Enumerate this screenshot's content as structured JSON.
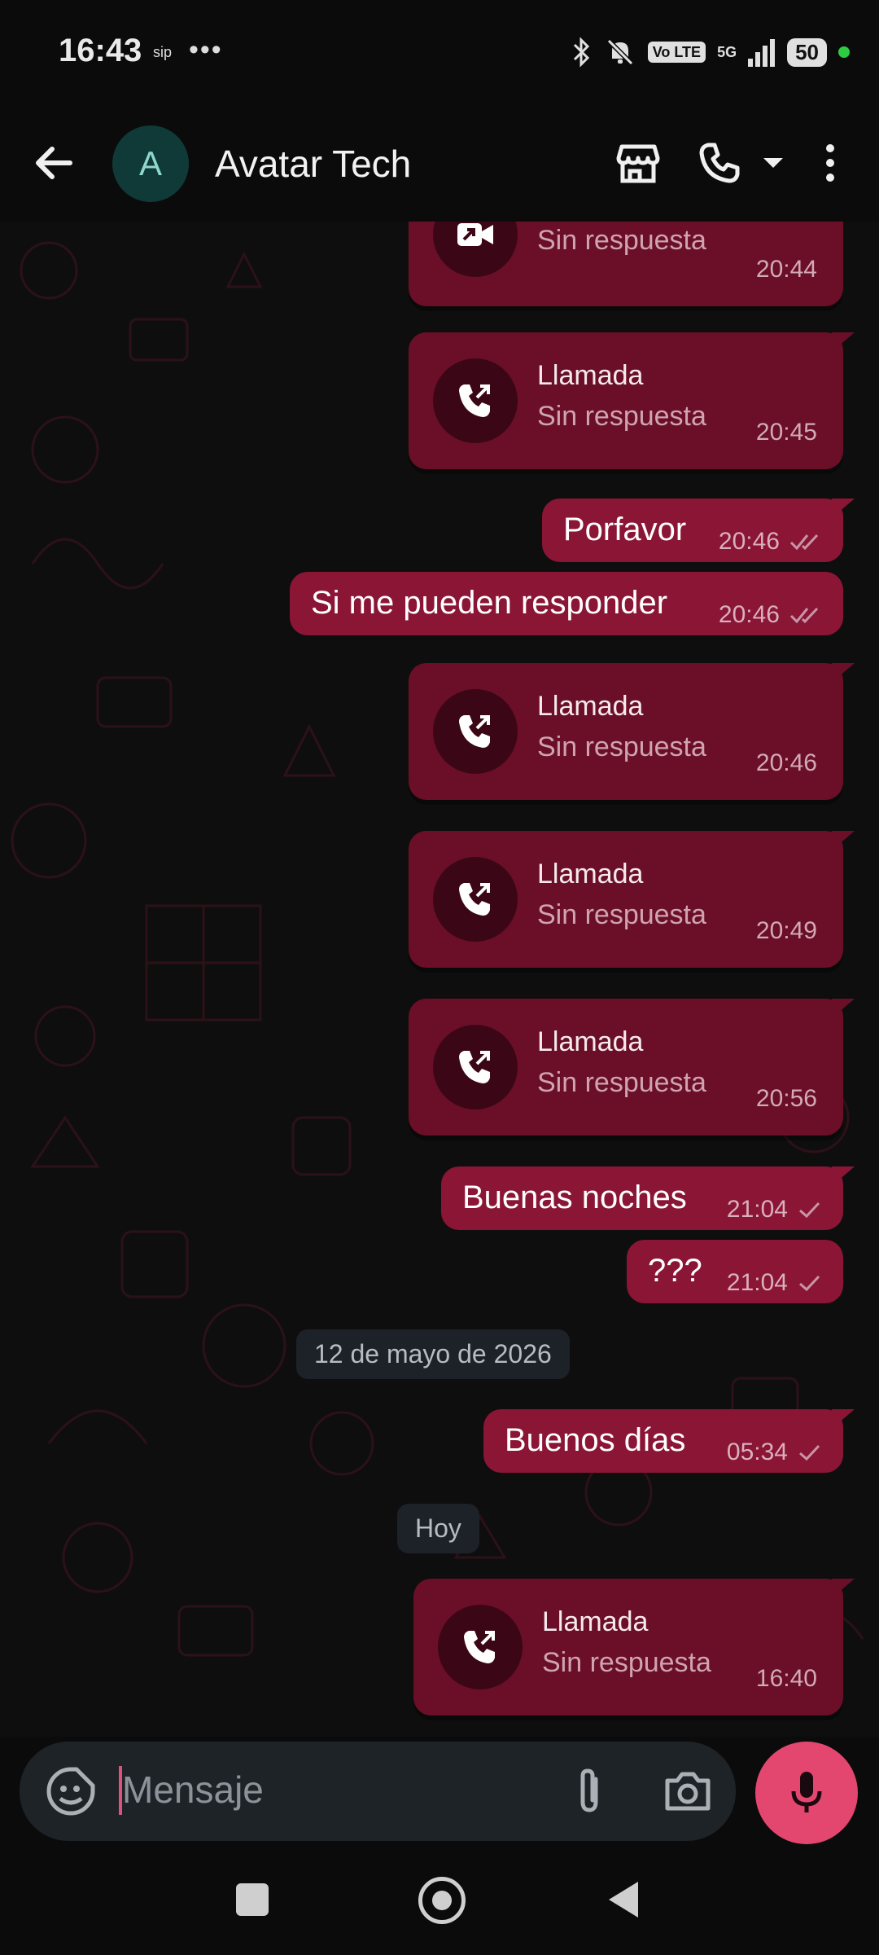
{
  "status_bar": {
    "time": "16:43",
    "sip": "sip",
    "dots": "•••",
    "volte": "Vo LTE",
    "network": "5G",
    "battery": "50"
  },
  "header": {
    "avatar_letter": "A",
    "contact_name": "Avatar Tech"
  },
  "messages": [
    {
      "type": "call",
      "title": "",
      "subtitle": "Sin respuesta",
      "time": "20:44",
      "video": true
    },
    {
      "type": "call",
      "title": "Llamada",
      "subtitle": "Sin respuesta",
      "time": "20:45"
    },
    {
      "type": "text",
      "text": "Porfavor",
      "time": "20:46",
      "status": "read"
    },
    {
      "type": "text",
      "text": "Si me pueden responder",
      "time": "20:46",
      "status": "read"
    },
    {
      "type": "call",
      "title": "Llamada",
      "subtitle": "Sin respuesta",
      "time": "20:46"
    },
    {
      "type": "call",
      "title": "Llamada",
      "subtitle": "Sin respuesta",
      "time": "20:49"
    },
    {
      "type": "call",
      "title": "Llamada",
      "subtitle": "Sin respuesta",
      "time": "20:56"
    },
    {
      "type": "text",
      "text": "Buenas noches",
      "time": "21:04",
      "status": "sent"
    },
    {
      "type": "text",
      "text": "???",
      "time": "21:04",
      "status": "sent"
    },
    {
      "type": "date",
      "text": "12 de mayo de 2026"
    },
    {
      "type": "text",
      "text": "Buenos días",
      "time": "05:34",
      "status": "sent"
    },
    {
      "type": "date",
      "text": "Hoy"
    },
    {
      "type": "call",
      "title": "Llamada",
      "subtitle": "Sin respuesta",
      "time": "16:40"
    }
  ],
  "input": {
    "placeholder": "Mensaje"
  },
  "colors": {
    "bubble": "#8a1535",
    "call_bubble": "#6a0f27",
    "mic": "#e3466e"
  }
}
